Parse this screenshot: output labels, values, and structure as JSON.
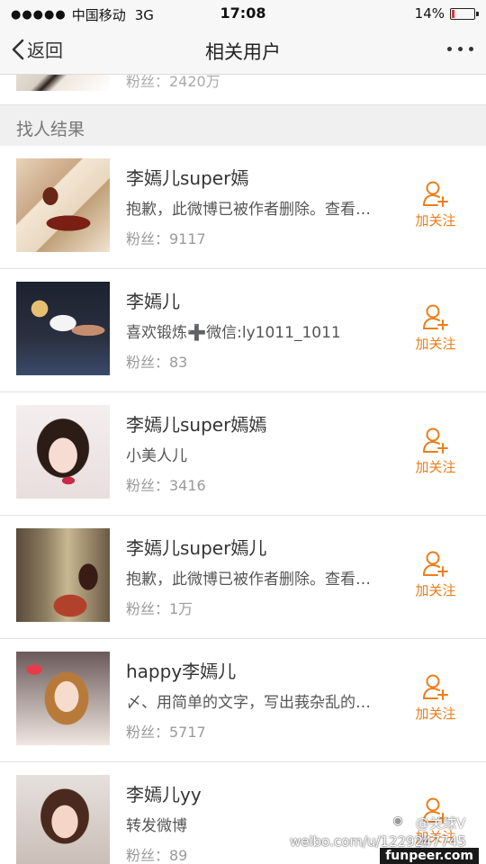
{
  "status_bar": {
    "signal": "●●●●●",
    "carrier": "中国移动",
    "network": "3G",
    "time": "17:08",
    "battery_percent": "14%",
    "battery_level": 0.14,
    "battery_color": "#e33333"
  },
  "nav": {
    "back_label": "返回",
    "title": "相关用户",
    "more_icon": "more-dots-icon"
  },
  "previous_row": {
    "fans": "粉丝：2420万"
  },
  "section": {
    "title": "找人结果"
  },
  "colors": {
    "accent": "#eb7d19",
    "section_bg": "#f0f0f0"
  },
  "users": [
    {
      "name": "李嫣儿super嫣",
      "desc": "抱歉，此微博已被作者删除。查看帮助：http://t.cn/zWSudZc",
      "fans": "粉丝：9117",
      "follow_label": "加关注"
    },
    {
      "name": "李嫣儿",
      "desc": "喜欢锻炼➕微信:ly1011_1011",
      "fans": "粉丝：83",
      "follow_label": "加关注"
    },
    {
      "name": "李嫣儿super嫣嫣",
      "desc": "小美人儿",
      "fans": "粉丝：3416",
      "follow_label": "加关注"
    },
    {
      "name": "李嫣儿super嫣儿",
      "desc": "抱歉，此微博已被作者删除。查看帮助：http://t.cn/zWSudZc",
      "fans": "粉丝：1万",
      "follow_label": "加关注"
    },
    {
      "name": "happy李嫣儿",
      "desc": "〆、用简单的文字，写出莪杂乱的心情",
      "fans": "粉丝：5717",
      "follow_label": "加关注"
    },
    {
      "name": "李嫣儿yy",
      "desc": "转发微博",
      "fans": "粉丝：89",
      "follow_label": "加关注"
    }
  ],
  "watermark": {
    "handle": "@关球V井",
    "url": "weibo.com/u/1229247745",
    "site": "funpeer.com"
  }
}
